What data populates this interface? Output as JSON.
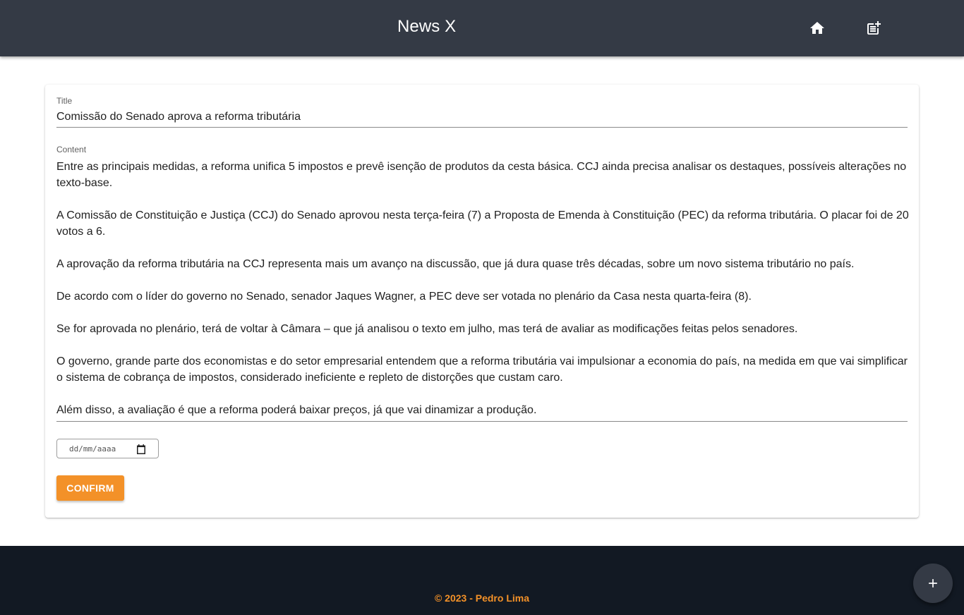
{
  "header": {
    "app_title": "News X",
    "home_icon": "home-icon",
    "new_post_icon": "post-add-icon"
  },
  "form": {
    "title_label": "Title",
    "title_value": "Comissão do Senado aprova a reforma tributária",
    "content_label": "Content",
    "content_paragraphs": [
      "Entre as principais medidas, a reforma unifica 5 impostos e prevê isenção de produtos da cesta básica. CCJ ainda precisa analisar os destaques, possíveis alterações no texto-base.",
      "A Comissão de Constituição e Justiça (CCJ) do Senado aprovou nesta terça-feira (7) a Proposta de Emenda à Constituição (PEC) da reforma tributária. O placar foi de 20 votos a 6.",
      "A aprovação da reforma tributária na CCJ representa mais um avanço na discussão, que já dura quase três décadas, sobre um novo sistema tributário no país.",
      "De acordo com o líder do governo no Senado, senador Jaques Wagner, a PEC deve ser votada no plenário da Casa nesta quarta-feira (8).",
      "Se for aprovada no plenário, terá de voltar à Câmara – que já analisou o texto em julho, mas terá de avaliar as modificações feitas pelos senadores.",
      "O governo, grande parte dos economistas e do setor empresarial entendem que a reforma tributária vai impulsionar a economia do país, na medida em que vai simplificar o sistema de cobrança de impostos, considerado ineficiente e repleto de distorções que custam caro.",
      "Além disso, a avaliação é que a reforma poderá baixar preços, já que vai dinamizar a produção."
    ],
    "date_placeholder": "dd/mm/aaaa",
    "confirm_label": "CONFIRM"
  },
  "footer": {
    "copyright": "© 2023 - Pedro Lima"
  },
  "fab": {
    "icon": "add-icon"
  },
  "colors": {
    "header_bg": "#343a45",
    "footer_bg": "#121923",
    "accent": "#f39128"
  }
}
